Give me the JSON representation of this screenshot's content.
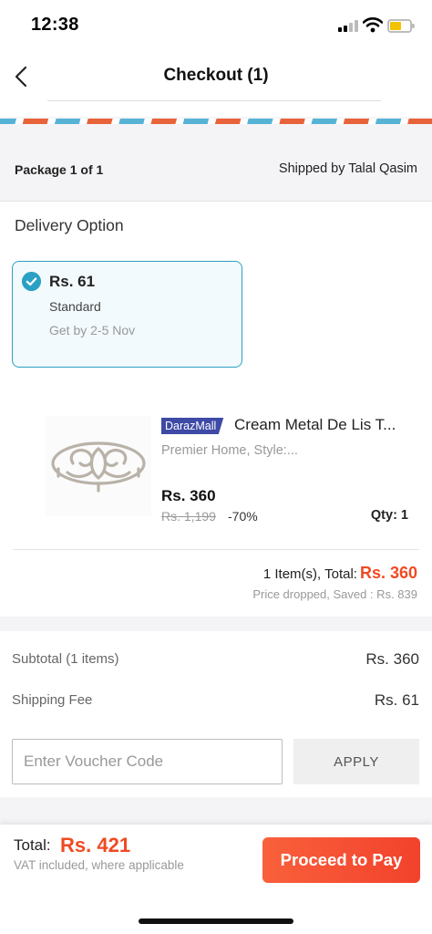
{
  "status_bar": {
    "time": "12:38"
  },
  "header": {
    "title": "Checkout (1)"
  },
  "package": {
    "label": "Package  1 of 1",
    "shipped_by": "Shipped by Talal Qasim"
  },
  "delivery": {
    "title": "Delivery Option",
    "option": {
      "price": "Rs. 61",
      "name": "Standard",
      "eta": "Get by 2-5 Nov",
      "selected": true
    }
  },
  "product": {
    "badge": "DarazMall",
    "name": "Cream Metal De Lis T...",
    "variant": "Premier Home, Style:...",
    "price": "Rs. 360",
    "original_price": "Rs. 1,199",
    "discount": "-70%",
    "qty": "Qty:  1"
  },
  "package_total": {
    "label": "1 Item(s), Total:",
    "amount": "Rs. 360",
    "saved": "Price dropped, Saved : Rs. 839"
  },
  "summary": {
    "subtotal_label": "Subtotal  (1 items)",
    "subtotal_value": "Rs. 360",
    "shipping_label": "Shipping Fee",
    "shipping_value": "Rs. 61"
  },
  "voucher": {
    "placeholder": "Enter Voucher Code",
    "value": "",
    "apply_label": "APPLY"
  },
  "footer": {
    "total_label": "Total:",
    "total_amount": "Rs. 421",
    "vat_note": "VAT included, where applicable",
    "proceed_label": "Proceed to Pay"
  },
  "colors": {
    "accent": "#f04a22",
    "selection": "#2aa0c4",
    "mall_badge": "#3e4aa6"
  },
  "icons": [
    "back-arrow-icon",
    "signal-icon",
    "wifi-icon",
    "battery-icon",
    "check-circle-icon"
  ]
}
